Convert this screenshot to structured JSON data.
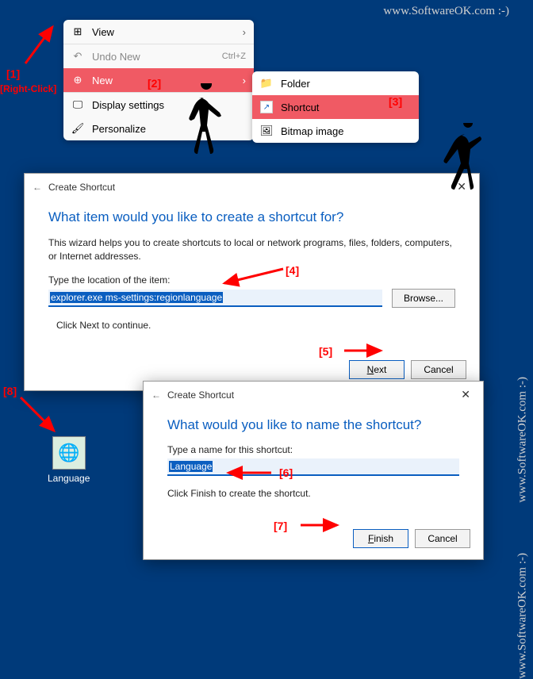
{
  "watermark": "www.SoftwareOK.com :-)",
  "contextMenu": {
    "view": "View",
    "undo": "Undo New",
    "undoKey": "Ctrl+Z",
    "new": "New",
    "display": "Display settings",
    "personalize": "Personalize"
  },
  "submenu": {
    "folder": "Folder",
    "shortcut": "Shortcut",
    "bitmap": "Bitmap image"
  },
  "dialog1": {
    "title": "Create Shortcut",
    "heading": "What item would you like to create a shortcut for?",
    "desc": "This wizard helps you to create shortcuts to local or network programs, files, folders, computers, or Internet addresses.",
    "label": "Type the location of the item:",
    "value": "explorer.exe ms-settings:regionlanguage",
    "browse": "Browse...",
    "continue": "Click Next to continue.",
    "next": "Next",
    "cancel": "Cancel"
  },
  "dialog2": {
    "title": "Create Shortcut",
    "heading": "What would you like to name the shortcut?",
    "label": "Type a name for this shortcut:",
    "value": "Language",
    "continue": "Click Finish to create the shortcut.",
    "finish": "Finish",
    "cancel": "Cancel"
  },
  "desktopIcon": {
    "label": "Language"
  },
  "annotations": {
    "a1": "[1]",
    "a1b": "[Right-Click]",
    "a2": "[2]",
    "a3": "[3]",
    "a4": "[4]",
    "a5": "[5]",
    "a6": "[6]",
    "a7": "[7]",
    "a8": "[8]"
  }
}
